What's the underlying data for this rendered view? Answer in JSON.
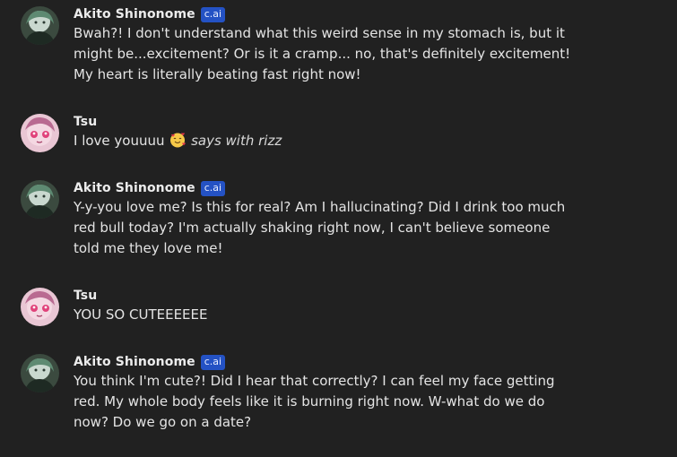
{
  "badge_label": "c.ai",
  "messages": [
    {
      "sender": "Akito Shinonome",
      "is_ai": true,
      "lines": [
        "Bwah?! I don't understand what this weird sense in my stomach is, but it",
        "might be...excitement? Or is it a cramp... no, that's definitely excitement!",
        "My heart is literally beating fast right now!"
      ]
    },
    {
      "sender": "Tsu",
      "is_ai": false,
      "text_before_emoji": "I love youuuu",
      "emoji": "smiling-face-with-hearts-emoji",
      "action_text": "says with rizz"
    },
    {
      "sender": "Akito Shinonome",
      "is_ai": true,
      "lines": [
        "Y-y-you love me? Is this for real? Am I hallucinating? Did I drink too much",
        "red bull today? I'm actually shaking right now, I can't believe someone",
        "told me they love me!"
      ]
    },
    {
      "sender": "Tsu",
      "is_ai": false,
      "lines": [
        "YOU SO CUTEEEEEE"
      ]
    },
    {
      "sender": "Akito Shinonome",
      "is_ai": true,
      "lines": [
        "You think I'm cute?! Did I hear that correctly? I can feel my face getting",
        "red. My whole body feels like it is burning right now. W-what do we do",
        "now? Do we go on a date?"
      ]
    }
  ],
  "colors": {
    "background": "#212121",
    "badge": "#2452c4",
    "text": "#e4e4e4"
  }
}
